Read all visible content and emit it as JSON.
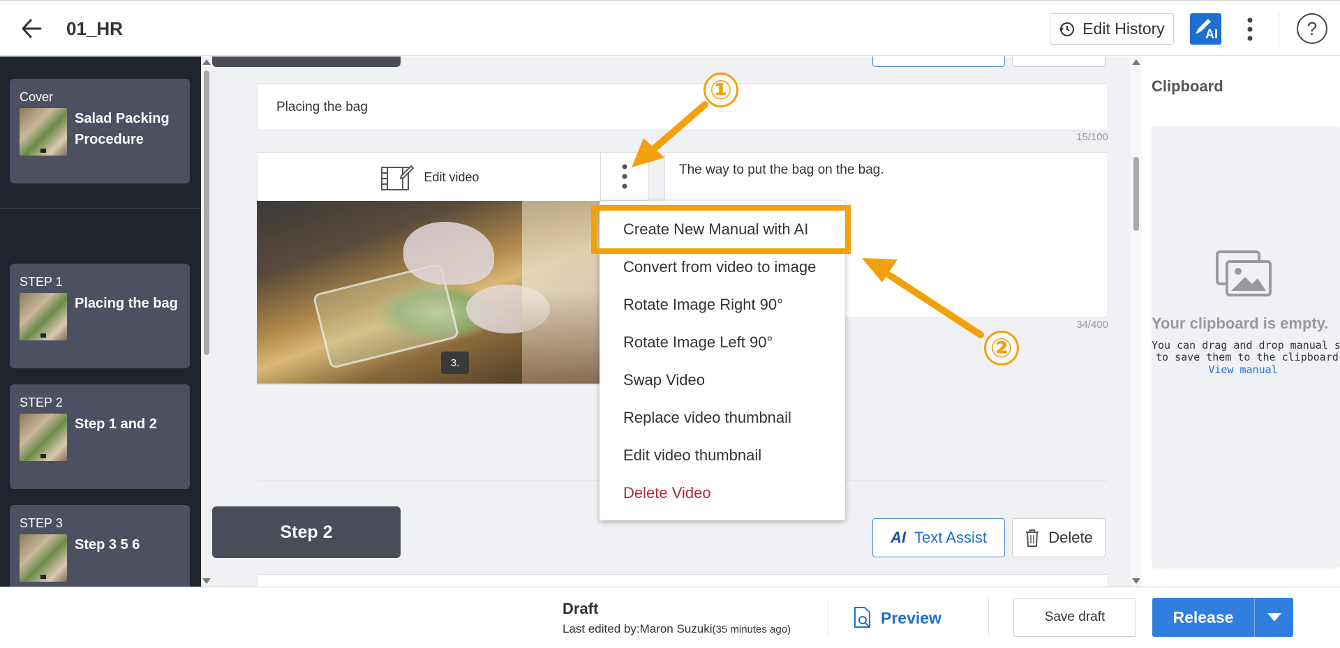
{
  "header": {
    "title": "01_HR",
    "edit_history_label": "Edit History",
    "ai_badge": "AI",
    "help": "?"
  },
  "sidebar": {
    "cards": [
      {
        "label": "Cover",
        "title": "Salad Packing Procedure"
      },
      {
        "label": "STEP 1",
        "title": "Placing the bag"
      },
      {
        "label": "STEP 2",
        "title": "Step 1 and 2"
      },
      {
        "label": "STEP 3",
        "title": "Step 3 5 6"
      }
    ]
  },
  "step": {
    "title_value": "Placing the bag",
    "title_count": "15/100",
    "edit_video_label": "Edit video",
    "frame_badge": "3.",
    "description_value": "The way to put the bag on the bag.",
    "description_count": "34/400"
  },
  "next_step": {
    "label": "Step 2",
    "text_assist_label": "Text Assist",
    "text_assist_ai": "AI",
    "delete_label": "Delete"
  },
  "menu": {
    "items": [
      "Create New Manual with AI",
      "Convert from video to image",
      "Rotate Image Right 90°",
      "Rotate Image Left 90°",
      "Swap Video",
      "Replace video thumbnail",
      "Edit video thumbnail",
      "Delete Video"
    ]
  },
  "clipboard": {
    "title": "Clipboard",
    "empty_title": "Your clipboard is empty.",
    "hint_line1": "You can drag and drop manual ste",
    "hint_line2": "to save them to the clipboard.",
    "link": "View manual"
  },
  "footer": {
    "status": "Draft",
    "last_edited": "Last edited by:Maron Suzuki",
    "ago": "(35 minutes ago)",
    "preview_label": "Preview",
    "save_draft_label": "Save draft",
    "release_label": "Release"
  },
  "annotations": {
    "callout_1": "①",
    "callout_2": "②"
  },
  "colors": {
    "accent": "#1f6fd1",
    "annotation": "#f2a10d",
    "danger": "#b3273a",
    "sidebar_bg": "#20242c",
    "card_bg": "#4d5060"
  }
}
